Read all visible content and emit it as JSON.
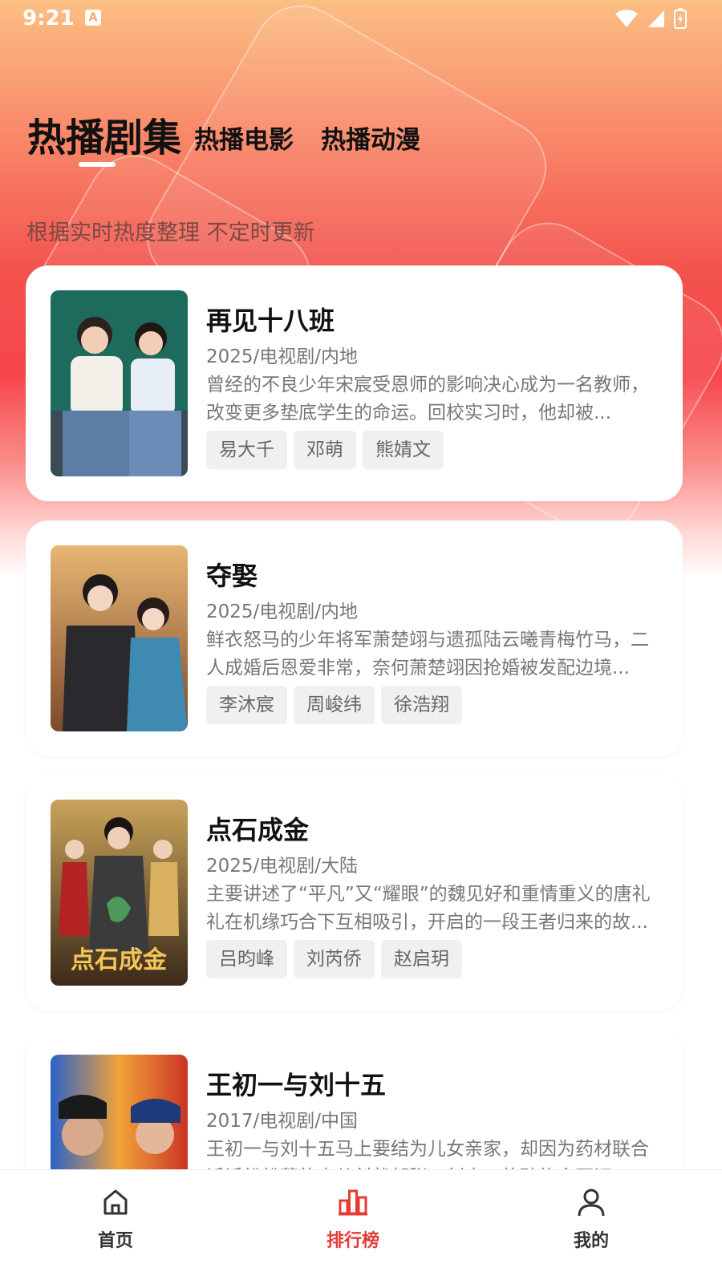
{
  "status_bar": {
    "time": "9:21",
    "notification_icon": "A"
  },
  "tabs": [
    {
      "label": "热播剧集",
      "active": true
    },
    {
      "label": "热播电影",
      "active": false
    },
    {
      "label": "热播动漫",
      "active": false
    }
  ],
  "subtitle": "根据实时热度整理 不定时更新",
  "items": [
    {
      "title": "再见十八班",
      "meta": "2025/电视剧/内地",
      "desc": "曾经的不良少年宋宸受恩师的影响决心成为一名教师，改变更多垫底学生的命运。回校实习时，他却被...",
      "tags": [
        "易大千",
        "邓萌",
        "熊婧文"
      ]
    },
    {
      "title": "夺娶",
      "meta": "2025/电视剧/内地",
      "desc": "鲜衣怒马的少年将军萧楚翊与遗孤陆云曦青梅竹马，二人成婚后恩爱非常，奈何萧楚翊因抢婚被发配边境...",
      "tags": [
        "李沐宸",
        "周峻纬",
        "徐浩翔"
      ]
    },
    {
      "title": "点石成金",
      "meta": "2025/电视剧/大陆",
      "desc": "主要讲述了“平凡”又“耀眼”的魏见好和重情重义的唐礼礼在机缘巧合下互相吸引，开启的一段王者归来的故...",
      "tags": [
        "吕昀峰",
        "刘芮侨",
        "赵启玥"
      ],
      "poster_text": "点石成金"
    },
    {
      "title": "王初一与刘十五",
      "meta": "2017/电视剧/中国",
      "desc": "王初一与刘十五马上要结为儿女亲家，却因为药材联合诉诉纷纷莫的表从斜状郁张，刘十五的聘约会不证...",
      "tags": []
    }
  ],
  "bottom_nav": [
    {
      "label": "首页",
      "icon": "home-icon",
      "active": false
    },
    {
      "label": "排行榜",
      "icon": "chart-icon",
      "active": true
    },
    {
      "label": "我的",
      "icon": "person-icon",
      "active": false
    }
  ],
  "colors": {
    "accent": "#e63b35",
    "gradient_top": "#fbbf84",
    "gradient_mid": "#f3524d"
  }
}
